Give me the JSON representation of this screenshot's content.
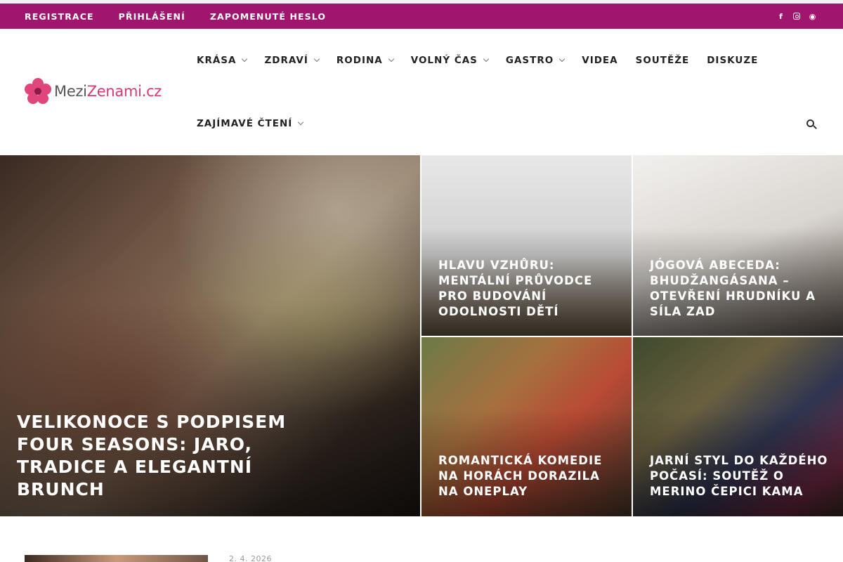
{
  "topbar": {
    "links": [
      "REGISTRACE",
      "PŘIHLÁŠENÍ",
      "ZAPOMENUTÉ HESLO"
    ],
    "social": [
      "facebook-icon",
      "instagram-icon",
      "rss-icon"
    ],
    "facebook_glyph": "f",
    "rss_glyph": "◉"
  },
  "logo": {
    "part1": "Mezi",
    "part2": "Zenami",
    "part3": ".cz"
  },
  "nav": {
    "row1": [
      {
        "label": "KRÁSA",
        "dropdown": true
      },
      {
        "label": "ZDRAVÍ",
        "dropdown": true
      },
      {
        "label": "RODINA",
        "dropdown": true
      },
      {
        "label": "VOLNÝ ČAS",
        "dropdown": true
      },
      {
        "label": "GASTRO",
        "dropdown": true
      },
      {
        "label": "VIDEA",
        "dropdown": false
      },
      {
        "label": "SOUTĚŽE",
        "dropdown": false
      },
      {
        "label": "DISKUZE",
        "dropdown": false
      }
    ],
    "row2": [
      {
        "label": "ZAJÍMAVÉ ČTENÍ",
        "dropdown": true
      }
    ]
  },
  "featured": {
    "main": {
      "title": "VELIKONOCE S PODPISEM FOUR SEASONS: JARO, TRADICE A ELEGANTNÍ BRUNCH"
    },
    "tiles": [
      {
        "title": "HLAVU VZHŮRU: MENTÁLNÍ PRŮVODCE PRO BUDOVÁNÍ ODOLNOSTI DĚTÍ"
      },
      {
        "title": "JÓGOVÁ ABECEDA: BHUDŽANGÁSANA – OTEVŘENÍ HRUDNÍKU A SÍLA ZAD"
      },
      {
        "title": "ROMANTICKÁ KOMEDIE NA HORÁCH DORAZILA NA ONEPLAY"
      },
      {
        "title": "JARNÍ STYL DO KAŽDÉHO POČASÍ: SOUTĚŽ O MERINO ČEPICI KAMA"
      }
    ]
  },
  "latest": {
    "date": "2. 4. 2026"
  },
  "colors": {
    "brand": "#a0166e",
    "logo_accent": "#d23b73"
  }
}
